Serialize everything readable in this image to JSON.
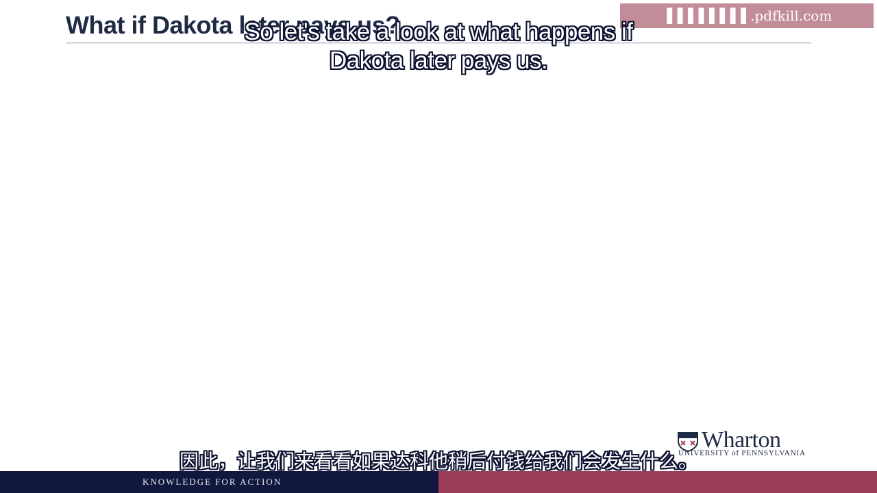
{
  "slide": {
    "title": "What if Dakota later pays us?"
  },
  "captions": {
    "english": "So let's take a look at what happens if Dakota later pays us.",
    "chinese": "因此，让我们来看看如果达科他稍后付钱给我们会发生什么。"
  },
  "watermark": {
    "text": "▐▐▐▐▐▐▐▐ .pdfkill.com"
  },
  "logo": {
    "name": "Wharton",
    "subtitle": "UNIVERSITY of PENNSYLVANIA",
    "shield_icon": "penn-shield-icon"
  },
  "footer": {
    "tagline": "KNOWLEDGE FOR ACTION"
  },
  "colors": {
    "navy": "#10193d",
    "maroon": "#9c3e5a",
    "title": "#1f2a44"
  }
}
